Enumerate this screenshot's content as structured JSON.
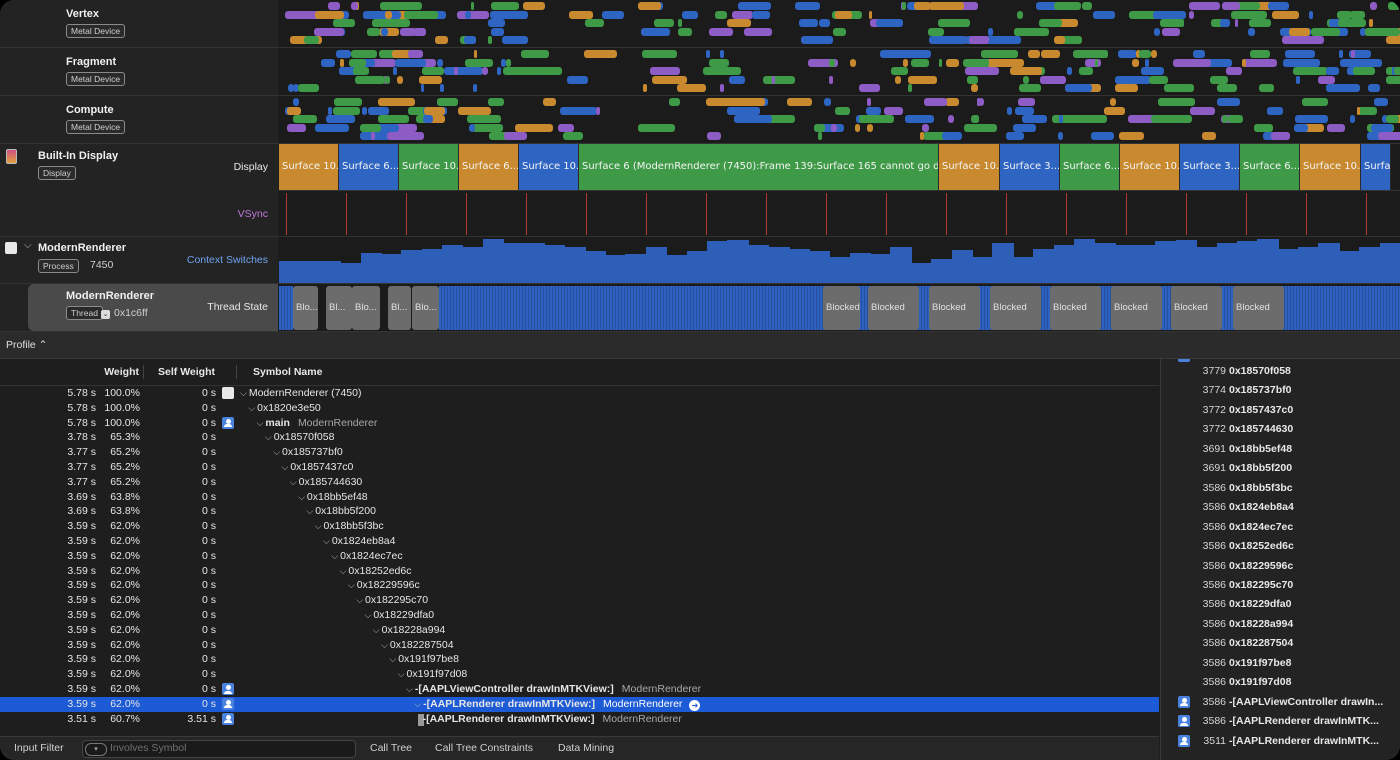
{
  "tracks": {
    "vertex": {
      "title": "Vertex",
      "badge": "Metal Device"
    },
    "fragment": {
      "title": "Fragment",
      "badge": "Metal Device"
    },
    "compute": {
      "title": "Compute",
      "badge": "Metal Device"
    },
    "display": {
      "title": "Built-In Display",
      "badge": "Display",
      "lane1": "Display",
      "lane2": "VSync"
    },
    "process": {
      "title": "ModernRenderer",
      "badge": "Process",
      "pid": "7450",
      "lane": "Context Switches"
    },
    "thread": {
      "title": "ModernRenderer",
      "badge": "Thread",
      "tid": "0x1c6ff",
      "lane": "Thread State"
    }
  },
  "surfaces": [
    {
      "label": "Surface 10...",
      "color": "#c98a2f"
    },
    {
      "label": "Surface 6...",
      "color": "#2f65c2"
    },
    {
      "label": "Surface 10...",
      "color": "#3f9a48"
    },
    {
      "label": "Surface 6...",
      "color": "#c98a2f"
    },
    {
      "label": "Surface 10...",
      "color": "#2f65c2"
    },
    {
      "label": "Surface 6 (ModernRenderer (7450):Frame 139:Surface 165 cannot go direct t...",
      "color": "#3f9a48"
    },
    {
      "label": "Surface 10...",
      "color": "#c98a2f"
    },
    {
      "label": "Surface 3...",
      "color": "#2f65c2"
    },
    {
      "label": "Surface 6...",
      "color": "#3f9a48"
    },
    {
      "label": "Surface 10...",
      "color": "#c98a2f"
    },
    {
      "label": "Surface 3...",
      "color": "#2f65c2"
    },
    {
      "label": "Surface 6...",
      "color": "#3f9a48"
    },
    {
      "label": "Surface 10...",
      "color": "#c98a2f"
    },
    {
      "label": "Surfac",
      "color": "#2f65c2"
    }
  ],
  "thread_states": [
    {
      "label": "Blo..."
    },
    {
      "label": "Bl..."
    },
    {
      "label": "Blo..."
    },
    {
      "label": "Bl..."
    },
    {
      "label": "Blo..."
    },
    {
      "label": "Blocked"
    },
    {
      "label": "Blocked"
    },
    {
      "label": "Blocked"
    },
    {
      "label": "Blocked"
    },
    {
      "label": "Blocked"
    },
    {
      "label": "Blocked"
    },
    {
      "label": "Blocked"
    },
    {
      "label": "Blocked"
    }
  ],
  "profile": {
    "selector": "Profile ⌃"
  },
  "call_tree": {
    "headers": {
      "weight": "Weight",
      "self_weight": "Self Weight",
      "symbol": "Symbol Name"
    },
    "rows": [
      {
        "w": "5.78 s",
        "p": "100.0%",
        "s": "0 s",
        "icon": "process",
        "depth": 0,
        "sym": "ModernRenderer (7450)",
        "lib": ""
      },
      {
        "w": "5.78 s",
        "p": "100.0%",
        "s": "0 s",
        "icon": "",
        "depth": 1,
        "sym": "0x1820e3e50",
        "lib": ""
      },
      {
        "w": "5.78 s",
        "p": "100.0%",
        "s": "0 s",
        "icon": "user",
        "depth": 2,
        "sym": "main",
        "lib": "ModernRenderer"
      },
      {
        "w": "3.78 s",
        "p": "65.3%",
        "s": "0 s",
        "icon": "",
        "depth": 3,
        "sym": "0x18570f058",
        "lib": ""
      },
      {
        "w": "3.77 s",
        "p": "65.2%",
        "s": "0 s",
        "icon": "",
        "depth": 4,
        "sym": "0x185737bf0",
        "lib": ""
      },
      {
        "w": "3.77 s",
        "p": "65.2%",
        "s": "0 s",
        "icon": "",
        "depth": 5,
        "sym": "0x1857437c0",
        "lib": ""
      },
      {
        "w": "3.77 s",
        "p": "65.2%",
        "s": "0 s",
        "icon": "",
        "depth": 6,
        "sym": "0x185744630",
        "lib": ""
      },
      {
        "w": "3.69 s",
        "p": "63.8%",
        "s": "0 s",
        "icon": "",
        "depth": 7,
        "sym": "0x18bb5ef48",
        "lib": ""
      },
      {
        "w": "3.69 s",
        "p": "63.8%",
        "s": "0 s",
        "icon": "",
        "depth": 8,
        "sym": "0x18bb5f200",
        "lib": ""
      },
      {
        "w": "3.59 s",
        "p": "62.0%",
        "s": "0 s",
        "icon": "",
        "depth": 9,
        "sym": "0x18bb5f3bc",
        "lib": ""
      },
      {
        "w": "3.59 s",
        "p": "62.0%",
        "s": "0 s",
        "icon": "",
        "depth": 10,
        "sym": "0x1824eb8a4",
        "lib": ""
      },
      {
        "w": "3.59 s",
        "p": "62.0%",
        "s": "0 s",
        "icon": "",
        "depth": 11,
        "sym": "0x1824ec7ec",
        "lib": ""
      },
      {
        "w": "3.59 s",
        "p": "62.0%",
        "s": "0 s",
        "icon": "",
        "depth": 12,
        "sym": "0x18252ed6c",
        "lib": ""
      },
      {
        "w": "3.59 s",
        "p": "62.0%",
        "s": "0 s",
        "icon": "",
        "depth": 13,
        "sym": "0x18229596c",
        "lib": ""
      },
      {
        "w": "3.59 s",
        "p": "62.0%",
        "s": "0 s",
        "icon": "",
        "depth": 14,
        "sym": "0x182295c70",
        "lib": ""
      },
      {
        "w": "3.59 s",
        "p": "62.0%",
        "s": "0 s",
        "icon": "",
        "depth": 15,
        "sym": "0x18229dfa0",
        "lib": ""
      },
      {
        "w": "3.59 s",
        "p": "62.0%",
        "s": "0 s",
        "icon": "",
        "depth": 16,
        "sym": "0x18228a994",
        "lib": ""
      },
      {
        "w": "3.59 s",
        "p": "62.0%",
        "s": "0 s",
        "icon": "",
        "depth": 17,
        "sym": "0x182287504",
        "lib": ""
      },
      {
        "w": "3.59 s",
        "p": "62.0%",
        "s": "0 s",
        "icon": "",
        "depth": 18,
        "sym": "0x191f97be8",
        "lib": ""
      },
      {
        "w": "3.59 s",
        "p": "62.0%",
        "s": "0 s",
        "icon": "",
        "depth": 19,
        "sym": "0x191f97d08",
        "lib": ""
      },
      {
        "w": "3.59 s",
        "p": "62.0%",
        "s": "0 s",
        "icon": "user",
        "depth": 20,
        "sym": "-[AAPLViewController drawInMTKView:]",
        "lib": "ModernRenderer"
      },
      {
        "w": "3.59 s",
        "p": "62.0%",
        "s": "0 s",
        "icon": "user",
        "depth": 21,
        "sym": "-[AAPLRenderer drawInMTKView:]",
        "lib": "ModernRenderer",
        "selected": true
      },
      {
        "w": "3.51 s",
        "p": "60.7%",
        "s": "3.51 s",
        "icon": "user",
        "depth": 22,
        "sym": "-[AAPLRenderer drawInMTKView:]",
        "lib": "ModernRenderer",
        "leaf": true
      }
    ]
  },
  "heaviest": [
    {
      "n": "3779",
      "sym": "0x18570f058",
      "icon": false
    },
    {
      "n": "3774",
      "sym": "0x185737bf0",
      "icon": false
    },
    {
      "n": "3772",
      "sym": "0x1857437c0",
      "icon": false
    },
    {
      "n": "3772",
      "sym": "0x185744630",
      "icon": false
    },
    {
      "n": "3691",
      "sym": "0x18bb5ef48",
      "icon": false
    },
    {
      "n": "3691",
      "sym": "0x18bb5f200",
      "icon": false
    },
    {
      "n": "3586",
      "sym": "0x18bb5f3bc",
      "icon": false
    },
    {
      "n": "3586",
      "sym": "0x1824eb8a4",
      "icon": false
    },
    {
      "n": "3586",
      "sym": "0x1824ec7ec",
      "icon": false
    },
    {
      "n": "3586",
      "sym": "0x18252ed6c",
      "icon": false
    },
    {
      "n": "3586",
      "sym": "0x18229596c",
      "icon": false
    },
    {
      "n": "3586",
      "sym": "0x182295c70",
      "icon": false
    },
    {
      "n": "3586",
      "sym": "0x18229dfa0",
      "icon": false
    },
    {
      "n": "3586",
      "sym": "0x18228a994",
      "icon": false
    },
    {
      "n": "3586",
      "sym": "0x182287504",
      "icon": false
    },
    {
      "n": "3586",
      "sym": "0x191f97be8",
      "icon": false
    },
    {
      "n": "3586",
      "sym": "0x191f97d08",
      "icon": false
    },
    {
      "n": "3586",
      "sym": "-[AAPLViewController drawIn...",
      "icon": true
    },
    {
      "n": "3586",
      "sym": "-[AAPLRenderer drawInMTK...",
      "icon": true
    },
    {
      "n": "3511",
      "sym": "-[AAPLRenderer drawInMTK...",
      "icon": true
    }
  ],
  "bottom": {
    "filter_label": "Input Filter",
    "filter_placeholder": "Involves Symbol",
    "tabs": [
      "Call Tree",
      "Call Tree Constraints",
      "Data Mining"
    ]
  },
  "colors": {
    "orange": "#c98a2f",
    "blue": "#2f65c2",
    "green": "#3f9a48",
    "purple": "#8d5cc4",
    "selection": "#1d5bd6"
  }
}
